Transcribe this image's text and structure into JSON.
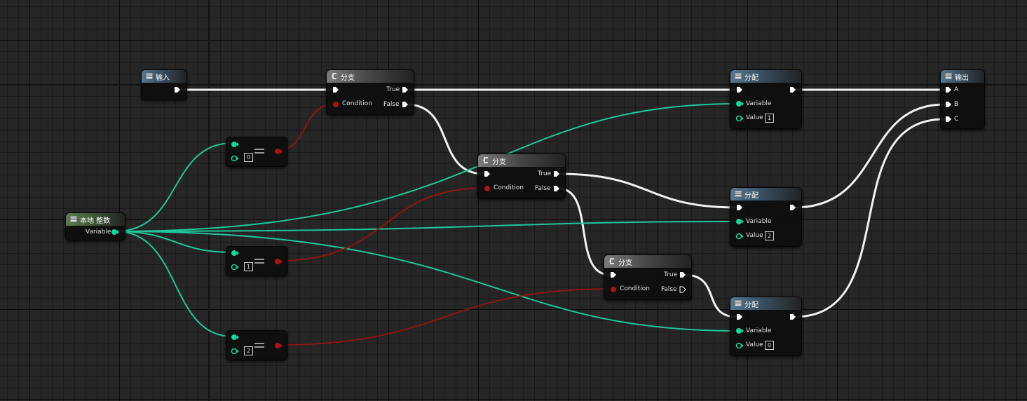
{
  "colors": {
    "exec": "#ffffff",
    "integer": "#1dd1a1",
    "boolean": "#a51616"
  },
  "nodes": {
    "input": {
      "title": "输入"
    },
    "local_int": {
      "title": "本地 整数",
      "variable_label": "Variable"
    },
    "eq_0": {
      "value": "0"
    },
    "eq_1": {
      "value": "1"
    },
    "eq_2": {
      "value": "2"
    },
    "branch_1": {
      "title": "分支",
      "true_label": "True",
      "false_label": "False",
      "condition_label": "Condition"
    },
    "branch_2": {
      "title": "分支",
      "true_label": "True",
      "false_label": "False",
      "condition_label": "Condition"
    },
    "branch_3": {
      "title": "分支",
      "true_label": "True",
      "false_label": "False",
      "condition_label": "Condition"
    },
    "assign_1": {
      "title": "分配",
      "variable_label": "Variable",
      "value_label": "Value",
      "value": "1"
    },
    "assign_2": {
      "title": "分配",
      "variable_label": "Variable",
      "value_label": "Value",
      "value": "2"
    },
    "assign_3": {
      "title": "分配",
      "variable_label": "Variable",
      "value_label": "Value",
      "value": "0"
    },
    "output": {
      "title": "输出",
      "pin_a": "A",
      "pin_b": "B",
      "pin_c": "C"
    }
  },
  "icons": {
    "function_node": "table-icon",
    "branch_node": "branch-icon",
    "exec_pin": "exec-arrow-icon",
    "data_pin": "data-pin-icon"
  }
}
